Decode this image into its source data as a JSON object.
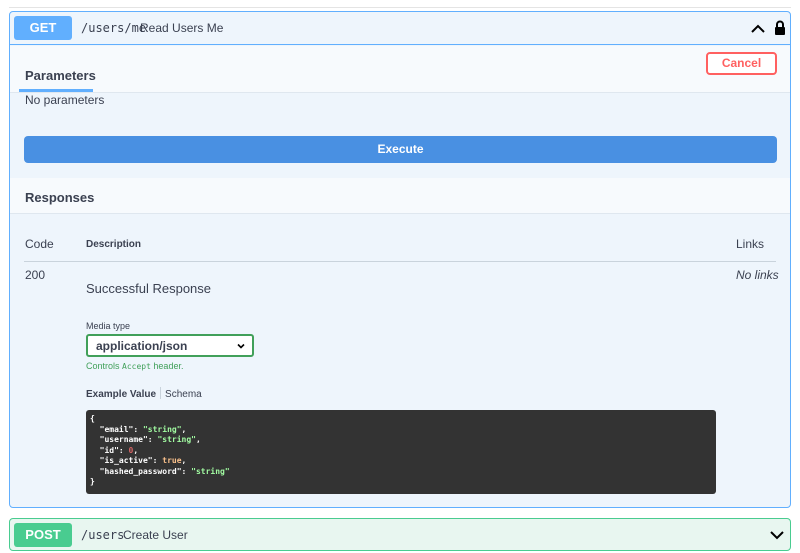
{
  "get_op": {
    "method": "GET",
    "path": "/users/me",
    "summary": "Read Users Me",
    "parameters_tab": "Parameters",
    "cancel_label": "Cancel",
    "no_parameters": "No parameters",
    "execute_label": "Execute",
    "responses_title": "Responses",
    "table_headers": {
      "code": "Code",
      "description": "Description",
      "links": "Links"
    },
    "response": {
      "code": "200",
      "description": "Successful Response",
      "links": "No links",
      "media_type_label": "Media type",
      "media_type_value": "application/json",
      "controls_prefix": "Controls ",
      "controls_mono": "Accept",
      "controls_suffix": " header.",
      "tab_example": "Example Value",
      "tab_schema": "Schema",
      "example_lines": [
        "{",
        "  \"email\": ",
        "\"string\"",
        ",",
        "  \"username\": ",
        "\"string\"",
        ",",
        "  \"id\": ",
        "0",
        ",",
        "  \"is_active\": ",
        "true",
        ",",
        "  \"hashed_password\": ",
        "\"string\"",
        "}"
      ]
    }
  },
  "post_op": {
    "method": "POST",
    "path": "/users",
    "summary": "Create User"
  },
  "colors": {
    "get": "#61affe",
    "post": "#49cc90",
    "execute": "#4990e2",
    "cancel": "#ff6060",
    "select_border": "#41a05a",
    "code_bg": "#333333"
  },
  "icons": {
    "get_collapse": "chevron-up-icon",
    "lock": "lock-icon",
    "select": "chevron-down-icon",
    "post_expand": "chevron-down-icon"
  }
}
